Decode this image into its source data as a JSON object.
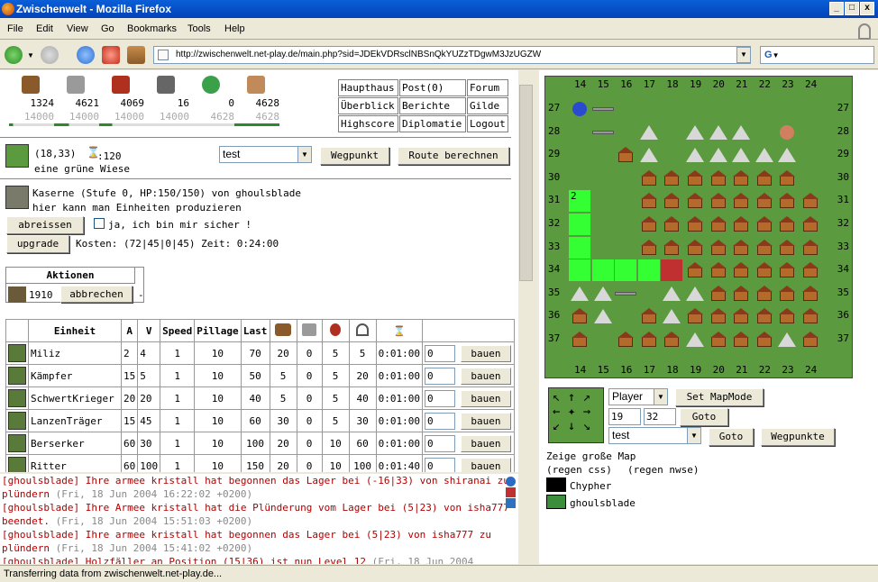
{
  "window": {
    "title": "Zwischenwelt - Mozilla Firefox"
  },
  "menu": [
    "File",
    "Edit",
    "View",
    "Go",
    "Bookmarks",
    "Tools",
    "Help"
  ],
  "url": "http://zwischenwelt.net-play.de/main.php?sid=JDEkVDRsclNBSnQkYUZzTDgwM3JzUGZW",
  "search_engine": "G",
  "resources": [
    {
      "icon": "wood-icon",
      "value": "1324",
      "max": "14000"
    },
    {
      "icon": "stone-icon",
      "value": "4621",
      "max": "14000"
    },
    {
      "icon": "food-icon",
      "value": "4069",
      "max": "14000"
    },
    {
      "icon": "metal-icon",
      "value": "16",
      "max": "14000"
    },
    {
      "icon": "crystal-icon",
      "value": "0",
      "max": "4628"
    },
    {
      "icon": "population-icon",
      "value": "4628",
      "max": "4628"
    }
  ],
  "nav_links": [
    "Haupthaus",
    "Post(0)",
    "Forum",
    "Überblick",
    "Berichte",
    "Gilde",
    "Highscore",
    "Diplomatie",
    "Logout"
  ],
  "tile": {
    "coords": "(18,33)",
    "hourglass": ":120",
    "desc": "eine grüne Wiese"
  },
  "route": {
    "select": "test",
    "waypoint_btn": "Wegpunkt",
    "route_btn": "Route berechnen"
  },
  "building": {
    "line1": "Kaserne (Stufe 0, HP:150/150) von ghoulsblade",
    "line2": "hier kann man Einheiten produzieren",
    "demolish_btn": "abreissen",
    "confirm_label": "ja, ich bin mir sicher !",
    "upgrade_btn": "upgrade",
    "cost": "Kosten: (72|45|0|45) Zeit: 0:24:00"
  },
  "actions": {
    "header": "Aktionen",
    "count": "1910",
    "cancel_btn": "abbrechen",
    "dash": "-"
  },
  "units_header": [
    "Einheit",
    "A",
    "V",
    "Speed",
    "Pillage",
    "Last"
  ],
  "units": [
    {
      "name": "Miliz",
      "a": "2",
      "v": "4",
      "speed": "1",
      "pillage": "10",
      "last": "70",
      "c1": "20",
      "c2": "0",
      "c3": "5",
      "c4": "5",
      "time": "0:01:00",
      "qty": "0",
      "btn": "bauen"
    },
    {
      "name": "Kämpfer",
      "a": "15",
      "v": "5",
      "speed": "1",
      "pillage": "10",
      "last": "50",
      "c1": "5",
      "c2": "0",
      "c3": "5",
      "c4": "20",
      "time": "0:01:00",
      "qty": "0",
      "btn": "bauen"
    },
    {
      "name": "SchwertKrieger",
      "a": "20",
      "v": "20",
      "speed": "1",
      "pillage": "10",
      "last": "40",
      "c1": "5",
      "c2": "0",
      "c3": "5",
      "c4": "40",
      "time": "0:01:00",
      "qty": "0",
      "btn": "bauen"
    },
    {
      "name": "LanzenTräger",
      "a": "15",
      "v": "45",
      "speed": "1",
      "pillage": "10",
      "last": "60",
      "c1": "30",
      "c2": "0",
      "c3": "5",
      "c4": "30",
      "time": "0:01:00",
      "qty": "0",
      "btn": "bauen"
    },
    {
      "name": "Berserker",
      "a": "60",
      "v": "30",
      "speed": "1",
      "pillage": "10",
      "last": "100",
      "c1": "20",
      "c2": "0",
      "c3": "10",
      "c4": "60",
      "time": "0:01:00",
      "qty": "0",
      "btn": "bauen"
    },
    {
      "name": "Ritter",
      "a": "60",
      "v": "100",
      "speed": "1",
      "pillage": "10",
      "last": "150",
      "c1": "20",
      "c2": "0",
      "c3": "10",
      "c4": "100",
      "time": "0:01:40",
      "qty": "0",
      "btn": "bauen"
    }
  ],
  "messages": [
    {
      "text": "[ghoulsblade] Ihre armee kristall hat begonnen das Lager bei (-16|33) von shiranai zu plündern",
      "ts": "(Fri, 18 Jun 2004 16:22:02 +0200)"
    },
    {
      "text": "[ghoulsblade] Ihre Armee kristall hat die Plünderung vom Lager bei (5|23) von isha777 beendet.",
      "ts": "(Fri, 18 Jun 2004 15:51:03 +0200)"
    },
    {
      "text": "[ghoulsblade] Ihre armee kristall hat begonnen das Lager bei (5|23) von isha777 zu plündern",
      "ts": "(Fri, 18 Jun 2004 15:41:02 +0200)"
    },
    {
      "text": "[ghoulsblade] Holzfäller an Position (15|36) ist nun Level 12",
      "ts": "(Fri, 18 Jun 2004"
    }
  ],
  "map": {
    "cols": [
      "14",
      "15",
      "16",
      "17",
      "18",
      "19",
      "20",
      "21",
      "22",
      "23",
      "24"
    ],
    "rows": [
      "27",
      "28",
      "29",
      "30",
      "31",
      "32",
      "33",
      "34",
      "35",
      "36",
      "37"
    ],
    "cell_mark": "2"
  },
  "map_controls": {
    "player_select": "Player",
    "mapmode_btn": "Set MapMode",
    "x": "19",
    "y": "32",
    "goto_btn": "Goto",
    "wp_select": "test",
    "goto2_btn": "Goto",
    "waypoints_btn": "Wegpunkte"
  },
  "map_info": {
    "big_map": "Zeige große Map",
    "regen_css": "(regen css)",
    "regen_nwse": "(regen nwse)"
  },
  "players": [
    {
      "name": "Chypher",
      "color": "#000000"
    },
    {
      "name": "ghoulsblade",
      "color": "#3c8d3c"
    }
  ],
  "status": "Transferring data from zwischenwelt.net-play.de..."
}
